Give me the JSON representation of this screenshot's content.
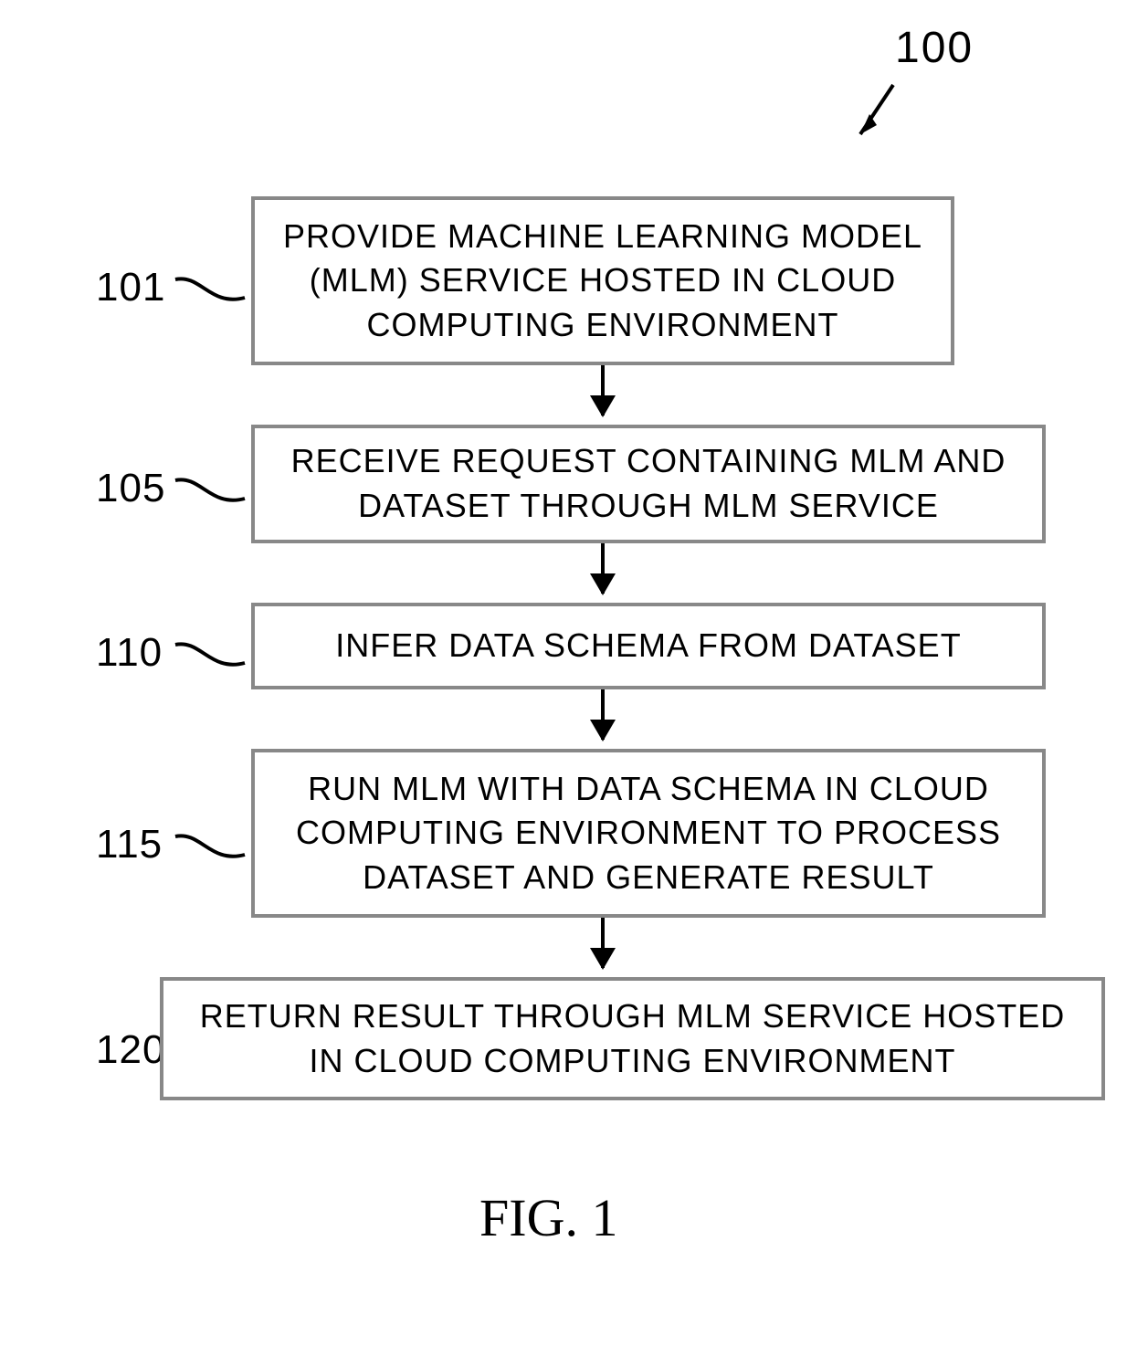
{
  "diagram": {
    "topLabel": "100",
    "caption": "FIG. 1",
    "steps": [
      {
        "num": "101",
        "text": "PROVIDE MACHINE LEARNING MODEL (MLM) SERVICE HOSTED IN CLOUD COMPUTING ENVIRONMENT"
      },
      {
        "num": "105",
        "text": "RECEIVE REQUEST CONTAINING MLM AND DATASET THROUGH MLM SERVICE"
      },
      {
        "num": "110",
        "text": "INFER DATA SCHEMA FROM DATASET"
      },
      {
        "num": "115",
        "text": "RUN MLM WITH DATA SCHEMA IN CLOUD COMPUTING ENVIRONMENT TO PROCESS DATASET AND GENERATE RESULT"
      },
      {
        "num": "120",
        "text": "RETURN RESULT THROUGH MLM SERVICE HOSTED IN CLOUD COMPUTING ENVIRONMENT"
      }
    ]
  }
}
